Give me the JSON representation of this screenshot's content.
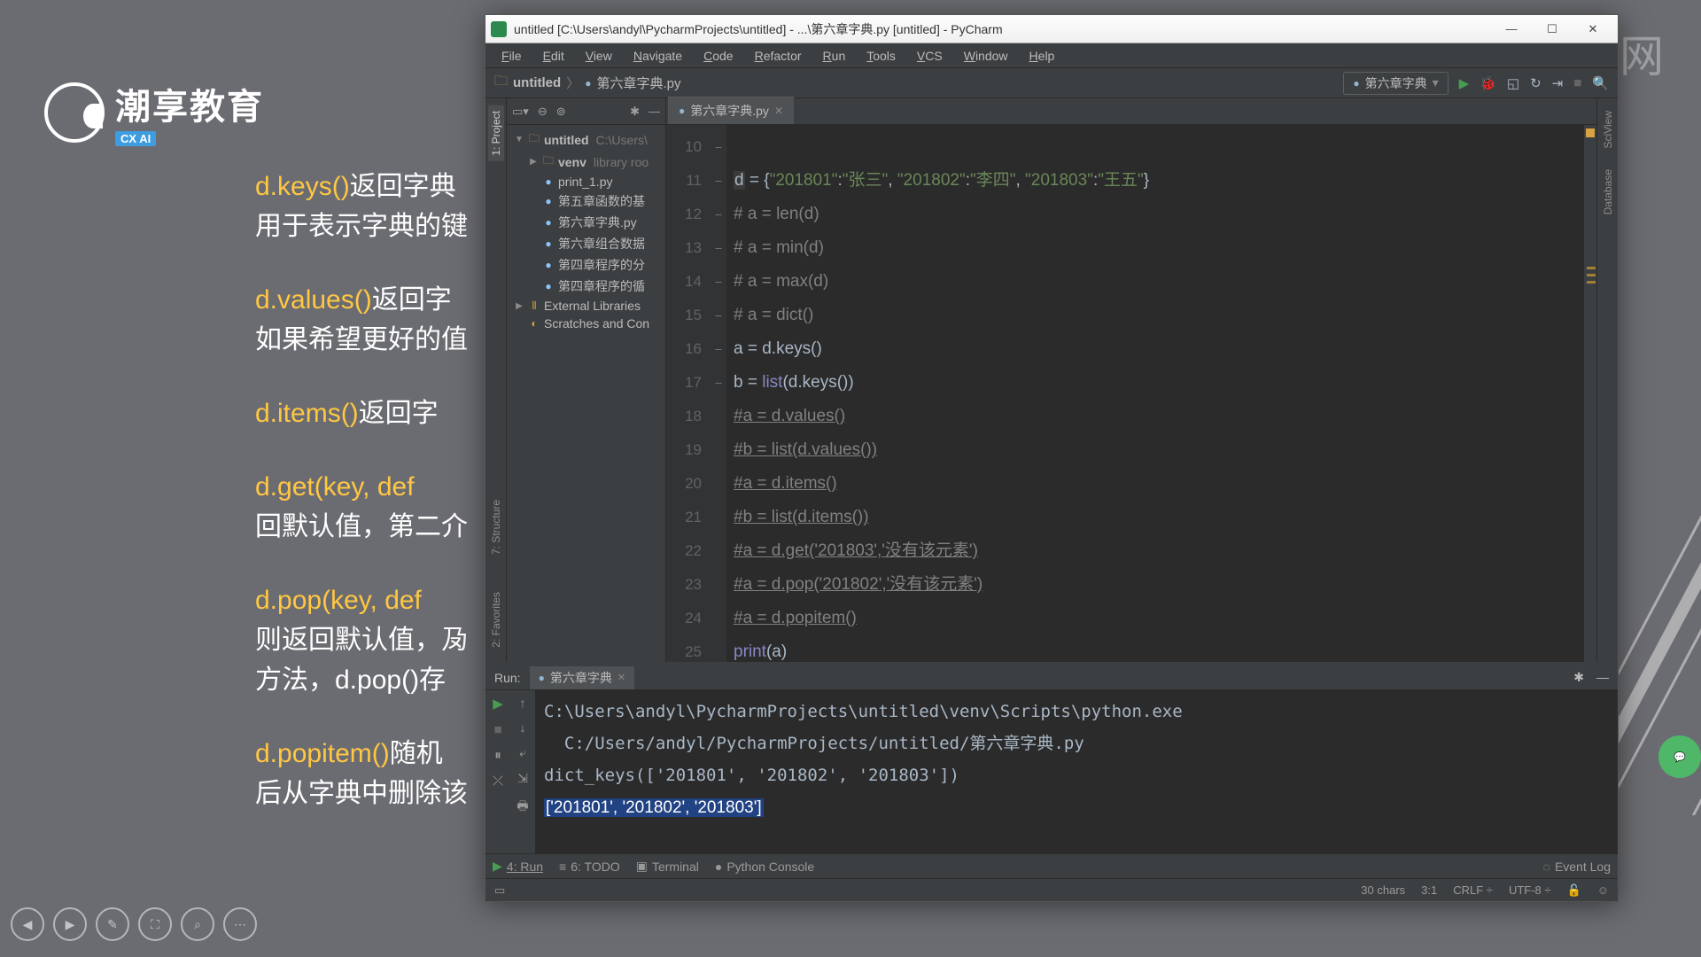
{
  "slide": {
    "logo_cn": "潮享教育",
    "logo_badge": "CX AI",
    "items": [
      {
        "key": "d.keys()",
        "line1": "返回字典",
        "line2": "用于表示字典的键"
      },
      {
        "key": "d.values()",
        "line1": "返回字",
        "line2": "如果希望更好的值"
      },
      {
        "key": "d.items()",
        "line1": "返回字",
        "line2": ""
      },
      {
        "key": "d.get(key, def",
        "line1": "",
        "line2_a": "回默认值，第二介"
      },
      {
        "key": "d.pop(key, def",
        "line1": "",
        "line2_a": "则返回默认值，夃",
        "line3": "方法，d.pop()存"
      },
      {
        "key": "d.popitem()",
        "line1": "随机",
        "line2": "后从字典中删除该"
      }
    ]
  },
  "watermark": {
    "box": "▶",
    "text": "虎课网"
  },
  "window": {
    "title": "untitled [C:\\Users\\andyl\\PycharmProjects\\untitled] - ...\\第六章字典.py [untitled] - PyCharm",
    "menus": [
      "File",
      "Edit",
      "View",
      "Navigate",
      "Code",
      "Refactor",
      "Run",
      "Tools",
      "VCS",
      "Window",
      "Help"
    ],
    "crumb": [
      {
        "icon": "folder",
        "text": "untitled"
      },
      {
        "icon": "py",
        "text": "第六章字典.py"
      }
    ],
    "run_config": "第六章字典",
    "project": {
      "root": "untitled",
      "root_path": "C:\\Users\\",
      "venv": "venv",
      "venv_note": "library roo",
      "files": [
        "print_1.py",
        "第五章函数的基",
        "第六章字典.py",
        "第六章组合数据",
        "第四章程序的分",
        "第四章程序的循"
      ],
      "ext_lib": "External Libraries",
      "scratches": "Scratches and Con"
    },
    "tab": "第六章字典.py",
    "code": {
      "start": 10,
      "lines": [
        {
          "n": 10,
          "raw": ""
        },
        {
          "n": 11,
          "parts": [
            {
              "t": "d",
              "c": "hl-caret"
            },
            {
              "t": " = {"
            },
            {
              "t": "\"201801\"",
              "c": "k-str"
            },
            {
              "t": ":"
            },
            {
              "t": "\"张三\"",
              "c": "k-str"
            },
            {
              "t": ", "
            },
            {
              "t": "\"201802\"",
              "c": "k-str"
            },
            {
              "t": ":"
            },
            {
              "t": "\"李四\"",
              "c": "k-str"
            },
            {
              "t": ", "
            },
            {
              "t": "\"201803\"",
              "c": "k-str"
            },
            {
              "t": ":"
            },
            {
              "t": "\"王五\"",
              "c": "k-str"
            },
            {
              "t": "}"
            }
          ]
        },
        {
          "n": 12,
          "parts": [
            {
              "t": "# a = len(d)",
              "c": "k-com"
            }
          ],
          "mark": "–"
        },
        {
          "n": 13,
          "parts": [
            {
              "t": "# a = min(d)",
              "c": "k-com"
            }
          ]
        },
        {
          "n": 14,
          "parts": [
            {
              "t": "# a = max(d)",
              "c": "k-com"
            }
          ],
          "mark": "–"
        },
        {
          "n": 15,
          "parts": [
            {
              "t": "# a = dict()",
              "c": "k-com"
            }
          ],
          "mark": "–"
        },
        {
          "n": 16,
          "parts": [
            {
              "t": "a = d.keys()"
            }
          ]
        },
        {
          "n": 17,
          "parts": [
            {
              "t": "b = "
            },
            {
              "t": "list",
              "c": "k-builtin"
            },
            {
              "t": "(d.keys())"
            }
          ]
        },
        {
          "n": 18,
          "parts": [
            {
              "t": "#a = d.values()",
              "c": "k-com underline"
            }
          ],
          "mark": "–"
        },
        {
          "n": 19,
          "parts": [
            {
              "t": "#b = list(d.values())",
              "c": "k-com underline"
            }
          ]
        },
        {
          "n": 20,
          "parts": [
            {
              "t": "#a = d.items()",
              "c": "k-com underline"
            }
          ],
          "mark": "–"
        },
        {
          "n": 21,
          "parts": [
            {
              "t": "#b = list(d.items())",
              "c": "k-com underline"
            }
          ]
        },
        {
          "n": 22,
          "parts": [
            {
              "t": "#a = d.get('201803','没有该元素')",
              "c": "k-com underline"
            }
          ],
          "mark": "–"
        },
        {
          "n": 23,
          "parts": [
            {
              "t": "#a = d.pop('201802','没有该元素')",
              "c": "k-com underline"
            }
          ],
          "mark": "–"
        },
        {
          "n": 24,
          "parts": [
            {
              "t": "#a = d.popitem()",
              "c": "k-com underline"
            }
          ],
          "mark": "–"
        },
        {
          "n": 25,
          "parts": [
            {
              "t": "print",
              "c": "k-builtin"
            },
            {
              "t": "(a)"
            }
          ]
        }
      ]
    },
    "run": {
      "label": "Run:",
      "tab": "第六章字典",
      "out1": "C:\\Users\\andyl\\PycharmProjects\\untitled\\venv\\Scripts\\python.exe",
      "out2": "  C:/Users/andyl/PycharmProjects/untitled/第六章字典.py",
      "out3": "dict_keys(['201801', '201802', '201803'])",
      "out4": "['201801', '201802', '201803']"
    },
    "bottom_tabs": {
      "run": "4: Run",
      "todo": "6: TODO",
      "terminal": "Terminal",
      "pyconsole": "Python Console",
      "eventlog": "Event Log"
    },
    "status": {
      "chars": "30 chars",
      "pos": "3:1",
      "eol": "CRLF",
      "enc": "UTF-8"
    }
  }
}
